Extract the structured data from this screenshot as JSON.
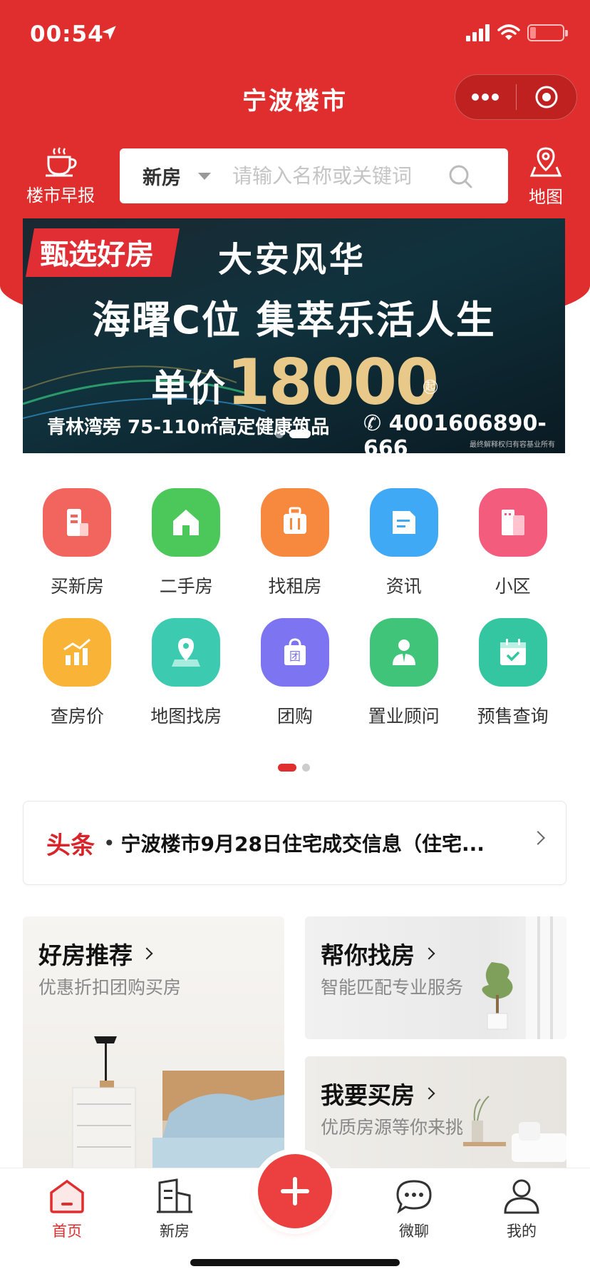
{
  "status_bar": {
    "time": "00:54"
  },
  "nav": {
    "title": "宁波楼市"
  },
  "header": {
    "morning_report_label": "楼市早报",
    "map_label": "地图",
    "search_type": "新房",
    "search_placeholder": "请输入名称或关键词"
  },
  "banner": {
    "tag": "甄选好房",
    "project": "大安风华",
    "slogan": "海曙C位 集萃乐活人生",
    "price_label": "单价",
    "price": "18000",
    "price_suffix": "起",
    "bottom_text": "青林湾旁 75-110㎡高定健康筑品",
    "phone": "4001606890-666",
    "note": "最终解释权归有容基业所有"
  },
  "grid": [
    {
      "label": "买新房",
      "icon": "building-icon",
      "color": "#f2655f"
    },
    {
      "label": "二手房",
      "icon": "house-icon",
      "color": "#4cc75a"
    },
    {
      "label": "找租房",
      "icon": "suitcase-icon",
      "color": "#f7893e"
    },
    {
      "label": "资讯",
      "icon": "news-icon",
      "color": "#3fa9f5"
    },
    {
      "label": "小区",
      "icon": "community-icon",
      "color": "#f45c7d"
    },
    {
      "label": "查房价",
      "icon": "price-chart-icon",
      "color": "#f9b438"
    },
    {
      "label": "地图找房",
      "icon": "map-pin-icon",
      "color": "#3ccab0"
    },
    {
      "label": "团购",
      "icon": "shopping-bag-icon",
      "color": "#7c74f1"
    },
    {
      "label": "置业顾问",
      "icon": "consultant-icon",
      "color": "#3fc47a"
    },
    {
      "label": "预售查询",
      "icon": "calendar-check-icon",
      "color": "#33c6a0"
    }
  ],
  "headline": {
    "tag": "头条",
    "text": "宁波楼市9月28日住宅成交信息（住宅..."
  },
  "cards": {
    "recommend": {
      "title": "好房推荐",
      "subtitle": "优惠折扣团购买房"
    },
    "help": {
      "title": "帮你找房",
      "subtitle": "智能匹配专业服务"
    },
    "buy": {
      "title": "我要买房",
      "subtitle": "优质房源等你来挑"
    }
  },
  "tabbar": {
    "home": "首页",
    "new_house": "新房",
    "chat": "微聊",
    "mine": "我的"
  },
  "colors": {
    "brand_red": "#e02d2d",
    "accent_red": "#d7262b"
  }
}
